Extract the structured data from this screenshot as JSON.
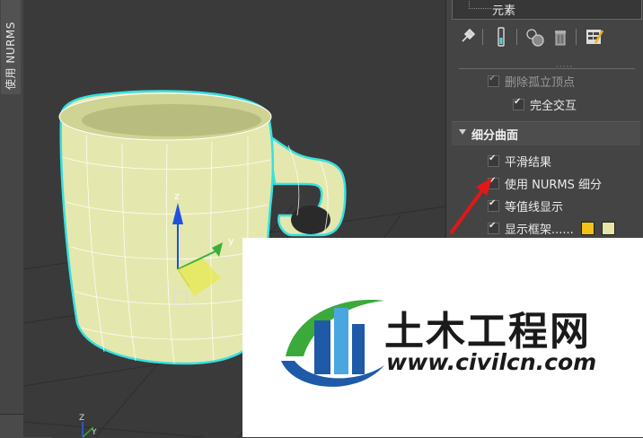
{
  "left_panel": {
    "vertical_tab_label": "使用 NURMS",
    "expand_chevron": "›"
  },
  "modifier_panel": {
    "tree_item": "元素",
    "toolbar_icons": [
      "pin-icon",
      "show-end-result-icon",
      "make-unique-icon",
      "remove-modifier-icon",
      "configure-modifier-sets-icon"
    ],
    "rows_above": [
      {
        "label": "删除孤立顶点",
        "checked": true,
        "enabled": false
      },
      {
        "label": "完全交互",
        "checked": true,
        "enabled": true
      }
    ],
    "section_title": "细分曲面",
    "options": [
      {
        "label": "平滑结果",
        "checked": true
      },
      {
        "label": "使用 NURMS 细分",
        "checked": true
      },
      {
        "label": "等值线显示",
        "checked": true
      },
      {
        "label": "显示框架......",
        "checked": true
      }
    ],
    "cage_colors": [
      "#f2c218",
      "#e6e4a6"
    ]
  },
  "viewport": {
    "gizmo_axis_z": "z",
    "gizmo_axis_y": "y",
    "bottom_axis_labels": [
      "Z",
      "Y"
    ]
  },
  "watermark": {
    "name": "土木工程网",
    "url": "www.civilcn.com",
    "colors": {
      "blue": "#1e5aa8",
      "green": "#3aaa3a",
      "light_blue": "#4aa6e0"
    }
  },
  "accent": {
    "annotation_arrow": "#e01818",
    "selection_outline": "#38e0e0",
    "mesh": "#e4e8ae"
  }
}
